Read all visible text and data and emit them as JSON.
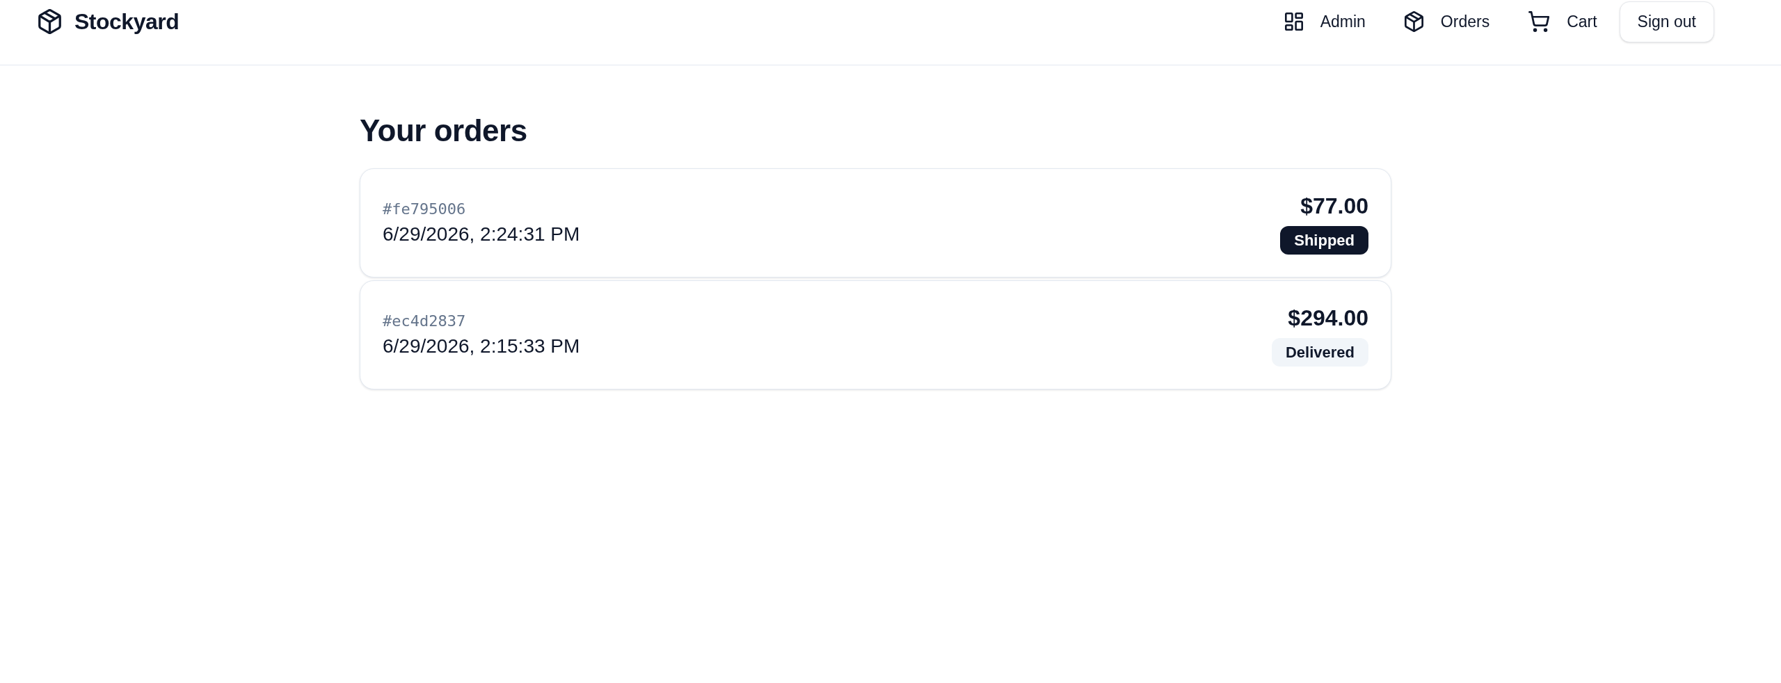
{
  "header": {
    "brand": "Stockyard",
    "nav": [
      {
        "kind": "admin",
        "label": "Admin"
      },
      {
        "kind": "orders",
        "label": "Orders"
      },
      {
        "kind": "cart",
        "label": "Cart"
      }
    ],
    "sign_out": "Sign out"
  },
  "page": {
    "title": "Your orders",
    "orders": [
      {
        "id": "#fe795006",
        "date": "6/29/2026, 2:24:31 PM",
        "total": "$77.00",
        "badge": {
          "label": "Shipped",
          "kind": "filled"
        }
      },
      {
        "id": "#ec4d2837",
        "date": "6/29/2026, 2:15:33 PM",
        "total": "$294.00",
        "badge": {
          "label": "Delivered",
          "kind": "subtle"
        }
      }
    ]
  }
}
